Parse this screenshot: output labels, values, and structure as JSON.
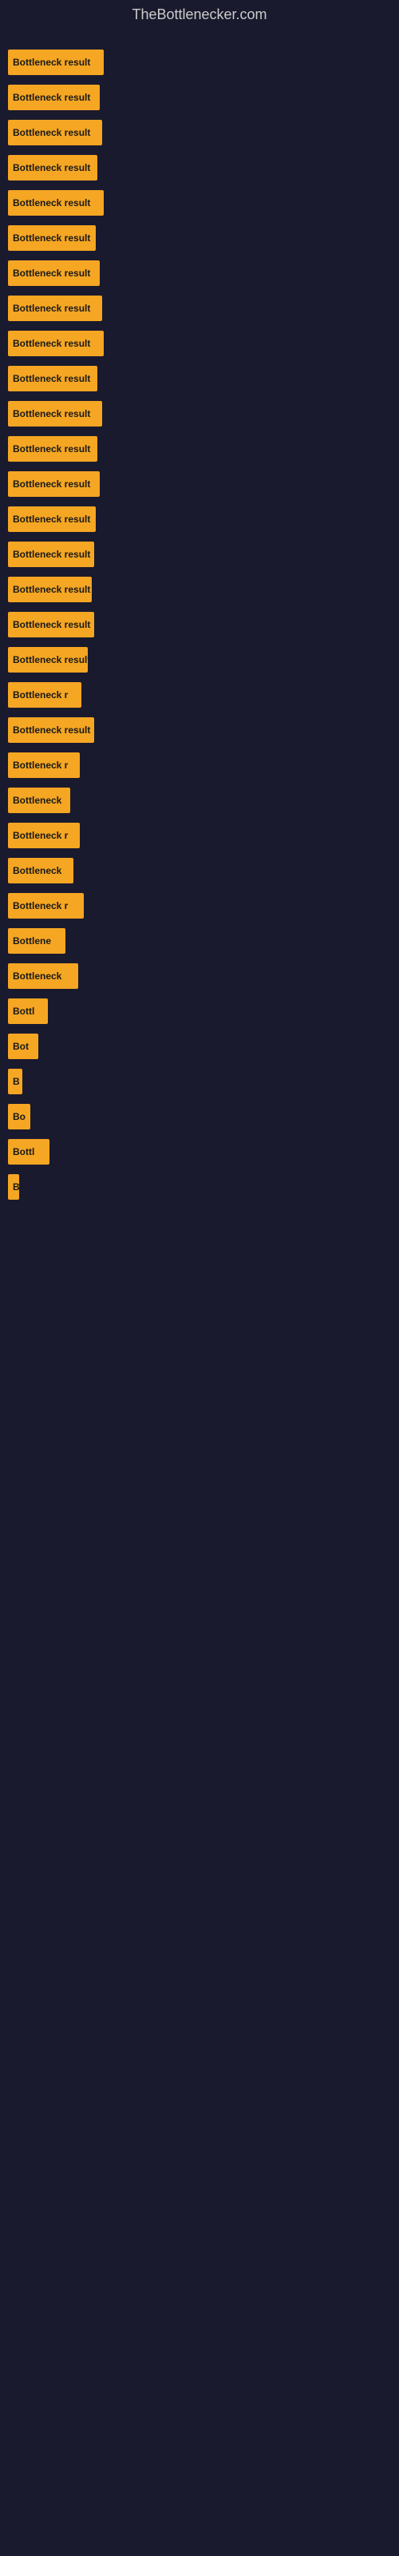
{
  "site": {
    "title": "TheBottlenecker.com"
  },
  "bars": [
    {
      "label": "Bottleneck result",
      "width": 120
    },
    {
      "label": "Bottleneck result",
      "width": 115
    },
    {
      "label": "Bottleneck result",
      "width": 118
    },
    {
      "label": "Bottleneck result",
      "width": 112
    },
    {
      "label": "Bottleneck result",
      "width": 120
    },
    {
      "label": "Bottleneck result",
      "width": 110
    },
    {
      "label": "Bottleneck result",
      "width": 115
    },
    {
      "label": "Bottleneck result",
      "width": 118
    },
    {
      "label": "Bottleneck result",
      "width": 120
    },
    {
      "label": "Bottleneck result",
      "width": 112
    },
    {
      "label": "Bottleneck result",
      "width": 118
    },
    {
      "label": "Bottleneck result",
      "width": 112
    },
    {
      "label": "Bottleneck result",
      "width": 115
    },
    {
      "label": "Bottleneck result",
      "width": 110
    },
    {
      "label": "Bottleneck result",
      "width": 108
    },
    {
      "label": "Bottleneck result",
      "width": 105
    },
    {
      "label": "Bottleneck result",
      "width": 108
    },
    {
      "label": "Bottleneck result",
      "width": 100
    },
    {
      "label": "Bottleneck re",
      "width": 92
    },
    {
      "label": "Bottleneck result",
      "width": 108
    },
    {
      "label": "Bottleneck re",
      "width": 90
    },
    {
      "label": "Bottleneck",
      "width": 78
    },
    {
      "label": "Bottleneck re",
      "width": 90
    },
    {
      "label": "Bottleneck r",
      "width": 82
    },
    {
      "label": "Bottleneck resu",
      "width": 95
    },
    {
      "label": "Bottlenec",
      "width": 72
    },
    {
      "label": "Bottleneck re",
      "width": 88
    },
    {
      "label": "Bottl",
      "width": 50
    },
    {
      "label": "Bot",
      "width": 38
    },
    {
      "label": "B",
      "width": 18
    },
    {
      "label": "Bo",
      "width": 28
    },
    {
      "label": "Bottle",
      "width": 52
    },
    {
      "label": "B",
      "width": 14
    }
  ]
}
